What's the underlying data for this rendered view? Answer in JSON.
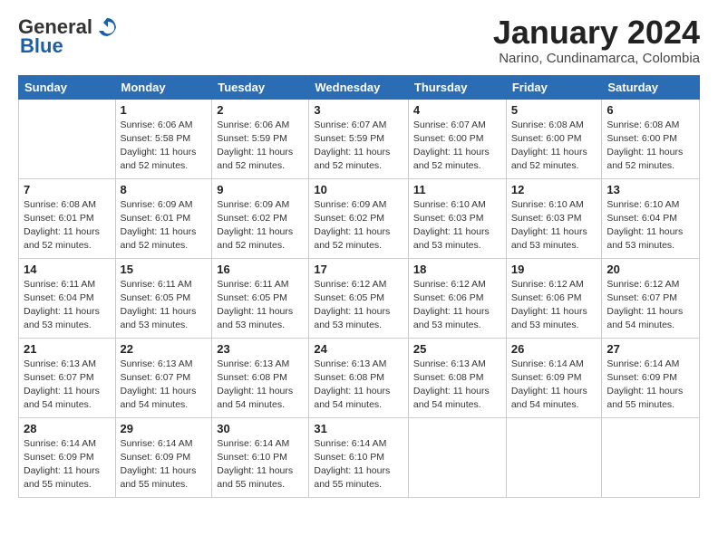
{
  "header": {
    "logo_line1": "General",
    "logo_line2": "Blue",
    "month_year": "January 2024",
    "location": "Narino, Cundinamarca, Colombia"
  },
  "days_of_week": [
    "Sunday",
    "Monday",
    "Tuesday",
    "Wednesday",
    "Thursday",
    "Friday",
    "Saturday"
  ],
  "weeks": [
    [
      {
        "day": "",
        "sunrise": "",
        "sunset": "",
        "daylight": ""
      },
      {
        "day": "1",
        "sunrise": "Sunrise: 6:06 AM",
        "sunset": "Sunset: 5:58 PM",
        "daylight": "Daylight: 11 hours and 52 minutes."
      },
      {
        "day": "2",
        "sunrise": "Sunrise: 6:06 AM",
        "sunset": "Sunset: 5:59 PM",
        "daylight": "Daylight: 11 hours and 52 minutes."
      },
      {
        "day": "3",
        "sunrise": "Sunrise: 6:07 AM",
        "sunset": "Sunset: 5:59 PM",
        "daylight": "Daylight: 11 hours and 52 minutes."
      },
      {
        "day": "4",
        "sunrise": "Sunrise: 6:07 AM",
        "sunset": "Sunset: 6:00 PM",
        "daylight": "Daylight: 11 hours and 52 minutes."
      },
      {
        "day": "5",
        "sunrise": "Sunrise: 6:08 AM",
        "sunset": "Sunset: 6:00 PM",
        "daylight": "Daylight: 11 hours and 52 minutes."
      },
      {
        "day": "6",
        "sunrise": "Sunrise: 6:08 AM",
        "sunset": "Sunset: 6:00 PM",
        "daylight": "Daylight: 11 hours and 52 minutes."
      }
    ],
    [
      {
        "day": "7",
        "sunrise": "Sunrise: 6:08 AM",
        "sunset": "Sunset: 6:01 PM",
        "daylight": "Daylight: 11 hours and 52 minutes."
      },
      {
        "day": "8",
        "sunrise": "Sunrise: 6:09 AM",
        "sunset": "Sunset: 6:01 PM",
        "daylight": "Daylight: 11 hours and 52 minutes."
      },
      {
        "day": "9",
        "sunrise": "Sunrise: 6:09 AM",
        "sunset": "Sunset: 6:02 PM",
        "daylight": "Daylight: 11 hours and 52 minutes."
      },
      {
        "day": "10",
        "sunrise": "Sunrise: 6:09 AM",
        "sunset": "Sunset: 6:02 PM",
        "daylight": "Daylight: 11 hours and 52 minutes."
      },
      {
        "day": "11",
        "sunrise": "Sunrise: 6:10 AM",
        "sunset": "Sunset: 6:03 PM",
        "daylight": "Daylight: 11 hours and 53 minutes."
      },
      {
        "day": "12",
        "sunrise": "Sunrise: 6:10 AM",
        "sunset": "Sunset: 6:03 PM",
        "daylight": "Daylight: 11 hours and 53 minutes."
      },
      {
        "day": "13",
        "sunrise": "Sunrise: 6:10 AM",
        "sunset": "Sunset: 6:04 PM",
        "daylight": "Daylight: 11 hours and 53 minutes."
      }
    ],
    [
      {
        "day": "14",
        "sunrise": "Sunrise: 6:11 AM",
        "sunset": "Sunset: 6:04 PM",
        "daylight": "Daylight: 11 hours and 53 minutes."
      },
      {
        "day": "15",
        "sunrise": "Sunrise: 6:11 AM",
        "sunset": "Sunset: 6:05 PM",
        "daylight": "Daylight: 11 hours and 53 minutes."
      },
      {
        "day": "16",
        "sunrise": "Sunrise: 6:11 AM",
        "sunset": "Sunset: 6:05 PM",
        "daylight": "Daylight: 11 hours and 53 minutes."
      },
      {
        "day": "17",
        "sunrise": "Sunrise: 6:12 AM",
        "sunset": "Sunset: 6:05 PM",
        "daylight": "Daylight: 11 hours and 53 minutes."
      },
      {
        "day": "18",
        "sunrise": "Sunrise: 6:12 AM",
        "sunset": "Sunset: 6:06 PM",
        "daylight": "Daylight: 11 hours and 53 minutes."
      },
      {
        "day": "19",
        "sunrise": "Sunrise: 6:12 AM",
        "sunset": "Sunset: 6:06 PM",
        "daylight": "Daylight: 11 hours and 53 minutes."
      },
      {
        "day": "20",
        "sunrise": "Sunrise: 6:12 AM",
        "sunset": "Sunset: 6:07 PM",
        "daylight": "Daylight: 11 hours and 54 minutes."
      }
    ],
    [
      {
        "day": "21",
        "sunrise": "Sunrise: 6:13 AM",
        "sunset": "Sunset: 6:07 PM",
        "daylight": "Daylight: 11 hours and 54 minutes."
      },
      {
        "day": "22",
        "sunrise": "Sunrise: 6:13 AM",
        "sunset": "Sunset: 6:07 PM",
        "daylight": "Daylight: 11 hours and 54 minutes."
      },
      {
        "day": "23",
        "sunrise": "Sunrise: 6:13 AM",
        "sunset": "Sunset: 6:08 PM",
        "daylight": "Daylight: 11 hours and 54 minutes."
      },
      {
        "day": "24",
        "sunrise": "Sunrise: 6:13 AM",
        "sunset": "Sunset: 6:08 PM",
        "daylight": "Daylight: 11 hours and 54 minutes."
      },
      {
        "day": "25",
        "sunrise": "Sunrise: 6:13 AM",
        "sunset": "Sunset: 6:08 PM",
        "daylight": "Daylight: 11 hours and 54 minutes."
      },
      {
        "day": "26",
        "sunrise": "Sunrise: 6:14 AM",
        "sunset": "Sunset: 6:09 PM",
        "daylight": "Daylight: 11 hours and 54 minutes."
      },
      {
        "day": "27",
        "sunrise": "Sunrise: 6:14 AM",
        "sunset": "Sunset: 6:09 PM",
        "daylight": "Daylight: 11 hours and 55 minutes."
      }
    ],
    [
      {
        "day": "28",
        "sunrise": "Sunrise: 6:14 AM",
        "sunset": "Sunset: 6:09 PM",
        "daylight": "Daylight: 11 hours and 55 minutes."
      },
      {
        "day": "29",
        "sunrise": "Sunrise: 6:14 AM",
        "sunset": "Sunset: 6:09 PM",
        "daylight": "Daylight: 11 hours and 55 minutes."
      },
      {
        "day": "30",
        "sunrise": "Sunrise: 6:14 AM",
        "sunset": "Sunset: 6:10 PM",
        "daylight": "Daylight: 11 hours and 55 minutes."
      },
      {
        "day": "31",
        "sunrise": "Sunrise: 6:14 AM",
        "sunset": "Sunset: 6:10 PM",
        "daylight": "Daylight: 11 hours and 55 minutes."
      },
      {
        "day": "",
        "sunrise": "",
        "sunset": "",
        "daylight": ""
      },
      {
        "day": "",
        "sunrise": "",
        "sunset": "",
        "daylight": ""
      },
      {
        "day": "",
        "sunrise": "",
        "sunset": "",
        "daylight": ""
      }
    ]
  ]
}
